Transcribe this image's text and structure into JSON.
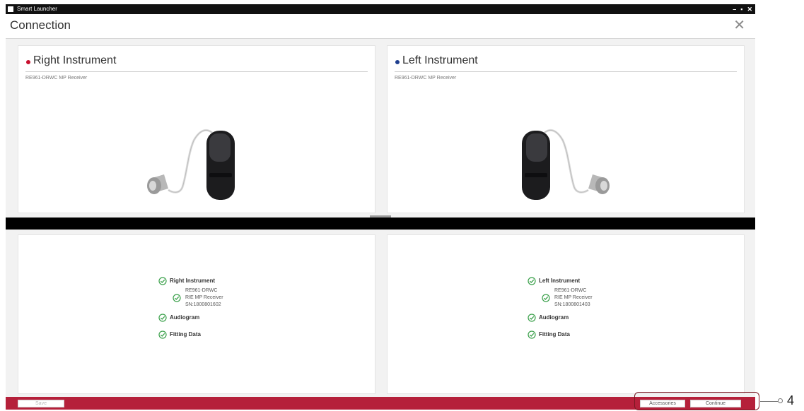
{
  "window": {
    "title": "Smart Launcher",
    "controls": [
      "–",
      "▪",
      "✕"
    ]
  },
  "header": {
    "title": "Connection",
    "close_glyph": "✕"
  },
  "instruments": {
    "right": {
      "title": "Right Instrument",
      "model": "RE961-DRWC MP Receiver",
      "dot_color": "#c8102e",
      "status": {
        "instrument_label": "Right Instrument",
        "detail": [
          "RE961-DRWC",
          "RIE MP Receiver",
          "SN:1800801602"
        ],
        "audiogram": "Audiogram",
        "fitting": "Fitting Data"
      }
    },
    "left": {
      "title": "Left Instrument",
      "model": "RE961-DRWC MP Receiver",
      "dot_color": "#1f3f8f",
      "status": {
        "instrument_label": "Left Instrument",
        "detail": [
          "RE961-DRWC",
          "RIE MP Receiver",
          "SN:1800801403"
        ],
        "audiogram": "Audiogram",
        "fitting": "Fitting Data"
      }
    }
  },
  "footer": {
    "save_label": "Save",
    "accessories_label": "Accessories",
    "continue_label": "Continue"
  },
  "callout": {
    "number": "4"
  },
  "colors": {
    "accent": "#b5203a",
    "check": "#3aa04a",
    "titlebar": "#111111"
  },
  "icons": {
    "check": "check-circle-icon",
    "close": "close-icon",
    "device": "hearing-aid-icon"
  }
}
